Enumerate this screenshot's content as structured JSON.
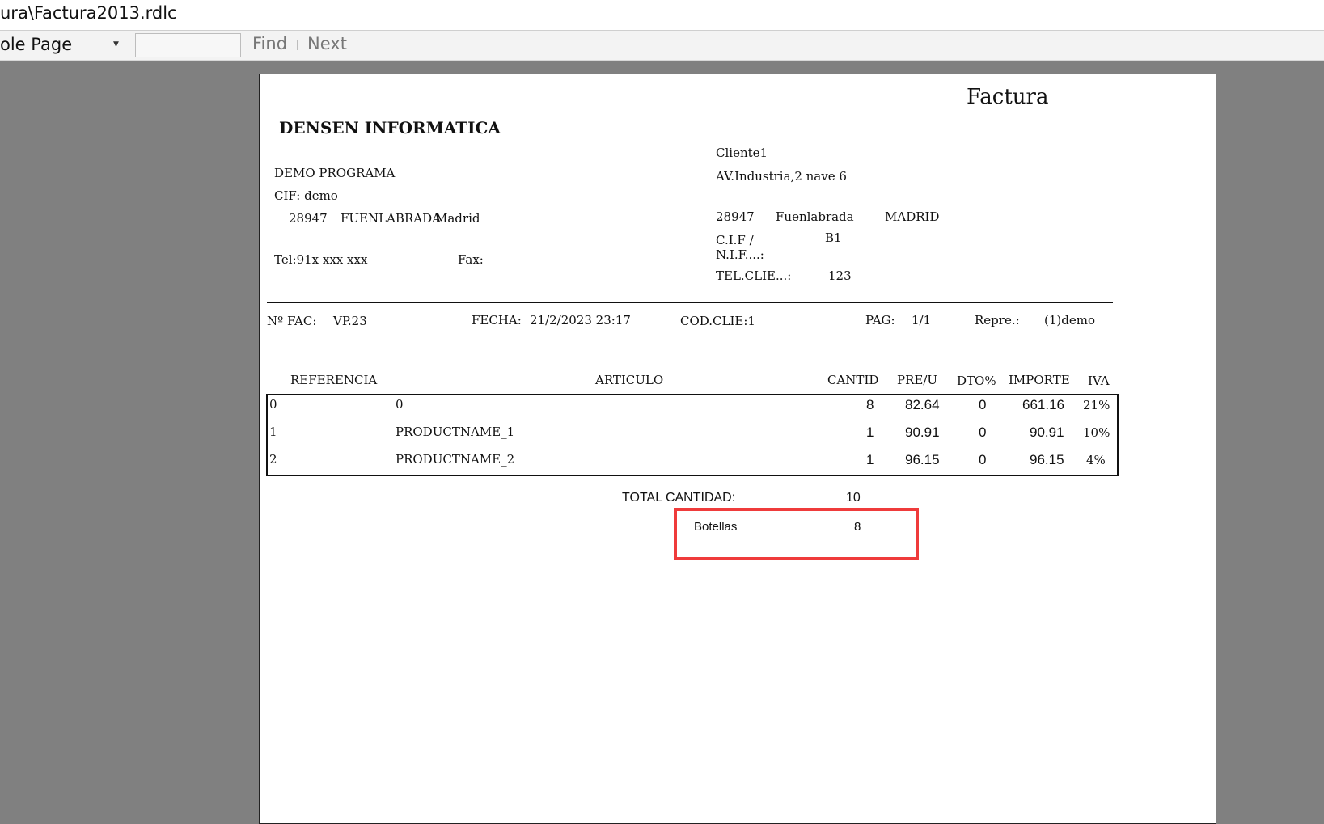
{
  "window": {
    "title": "ura\\Factura2013.rdlc"
  },
  "toolbar": {
    "view_mode": "ole Page",
    "find_label": "Find",
    "next_label": "Next",
    "search_value": ""
  },
  "report": {
    "title": "Factura",
    "company": {
      "name": "DENSEN INFORMATICA",
      "line1": "DEMO PROGRAMA",
      "cif": "CIF: demo",
      "postal": "28947",
      "city": "FUENLABRADA",
      "province": "Madrid",
      "tel": "Tel:91x xxx xxx",
      "fax": "Fax:"
    },
    "client": {
      "name": "Cliente1",
      "address": "AV.Industria,2 nave 6",
      "postal": "28947",
      "city": "Fuenlabrada",
      "province": "MADRID",
      "cif_label_1": "C.I.F /",
      "cif_label_2": "N.I.F....:",
      "cif_value": "B1",
      "tel_label": "TEL.CLIE...:",
      "tel_value": "123"
    },
    "info": {
      "fac_label": "Nº FAC:",
      "fac_value": "VP.23",
      "fecha_label": "FECHA:",
      "fecha_value": "21/2/2023 23:17",
      "codclie": "COD.CLIE:1",
      "pag_label": "PAG:",
      "pag_value": "1/1",
      "repre_label": "Repre.:",
      "repre_value": "(1)demo"
    },
    "columns": {
      "referencia": "REFERENCIA",
      "articulo": "ARTICULO",
      "cantid": "CANTID",
      "preu": "PRE/U",
      "dto": "DTO%",
      "importe": "IMPORTE",
      "iva": "IVA"
    },
    "rows": [
      {
        "ref": "0",
        "articulo": "0",
        "cantid": "8",
        "preu": "82.64",
        "dto": "0",
        "importe": "661.16",
        "iva": "21%"
      },
      {
        "ref": "1",
        "articulo": "PRODUCTNAME_1",
        "cantid": "1",
        "preu": "90.91",
        "dto": "0",
        "importe": "90.91",
        "iva": "10%"
      },
      {
        "ref": "2",
        "articulo": "PRODUCTNAME_2",
        "cantid": "1",
        "preu": "96.15",
        "dto": "0",
        "importe": "96.15",
        "iva": "4%"
      }
    ],
    "totals": {
      "total_cantidad_label": "TOTAL CANTIDAD:",
      "total_cantidad_value": "10",
      "botellas_label": "Botellas",
      "botellas_value": "8"
    }
  },
  "colors": {
    "highlight": "#ef3b3b",
    "viewer_bg": "#808080"
  }
}
